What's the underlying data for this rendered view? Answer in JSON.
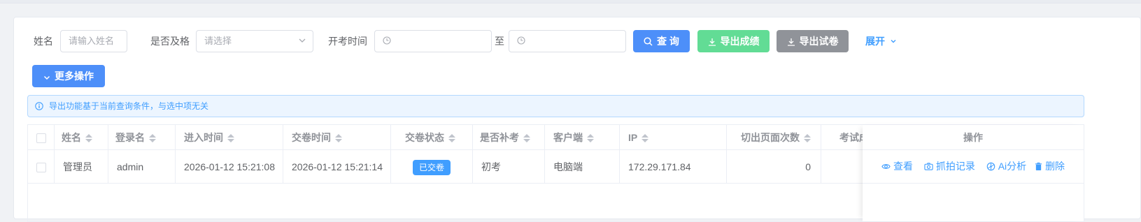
{
  "filters": {
    "name_label": "姓名",
    "name_placeholder": "请输入姓名",
    "pass_label": "是否及格",
    "pass_placeholder": "请选择",
    "time_label": "开考时间",
    "time_sep": "至"
  },
  "buttons": {
    "query": "查 询",
    "export_scores": "导出成绩",
    "export_papers": "导出试卷",
    "expand": "展开",
    "more_ops": "更多操作"
  },
  "alert": {
    "text": "导出功能基于当前查询条件，与选中项无关"
  },
  "table": {
    "columns": [
      "姓名",
      "登录名",
      "进入时间",
      "交卷时间",
      "交卷状态",
      "是否补考",
      "客户端",
      "IP",
      "切出页面次数",
      "考试成"
    ],
    "actions_header": "操作",
    "rows": [
      {
        "name": "管理员",
        "login": "admin",
        "enter_time": "2026-01-12 15:21:08",
        "submit_time": "2026-01-12 15:21:14",
        "status": "已交卷",
        "makeup": "初考",
        "client": "电脑端",
        "ip": "172.29.171.84",
        "switch_count": "0"
      }
    ],
    "actions": {
      "view": "查看",
      "capture": "抓拍记录",
      "ai": "Ai分析",
      "delete": "删除"
    }
  },
  "colors": {
    "primary": "#4d8ff9",
    "success": "#62dc95",
    "info": "#909399"
  }
}
